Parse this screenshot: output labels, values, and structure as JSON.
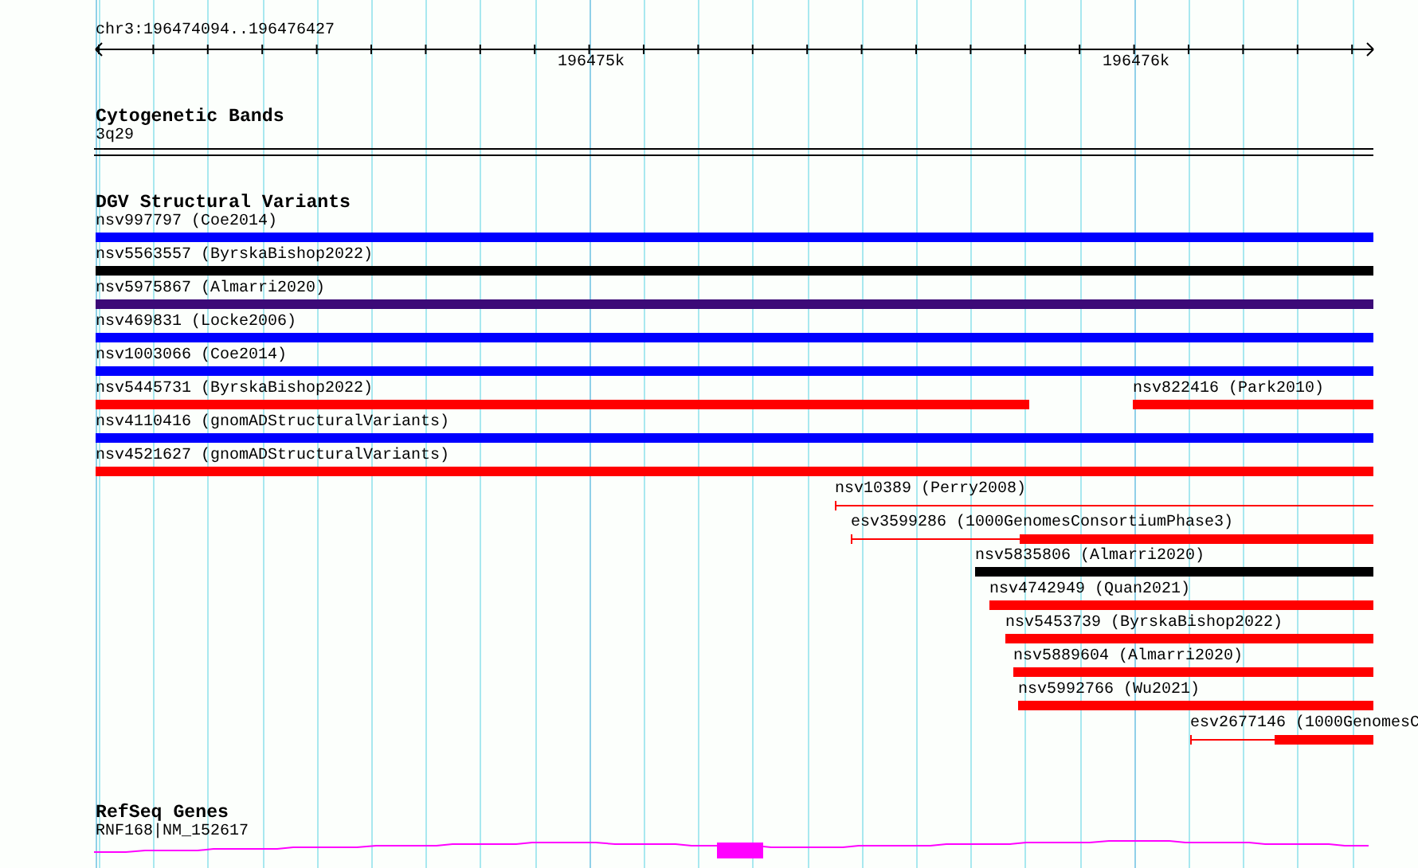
{
  "ruler": {
    "location": "chr3:196474094..196476427",
    "ticks": [
      "196475k",
      "196476k"
    ]
  },
  "tracks": [
    {
      "kind": "bands",
      "title": "Cytogenetic Bands",
      "features": [
        {
          "label": "3q29"
        }
      ]
    },
    {
      "kind": "variants",
      "title": "DGV Structural Variants",
      "rows": [
        [
          {
            "label": "nsv997797 (Coe2014)",
            "color": "#0000ff",
            "kind": "solid"
          }
        ],
        [
          {
            "label": "nsv5563557 (ByrskaBishop2022)",
            "color": "#000000",
            "kind": "solid"
          }
        ],
        [
          {
            "label": "nsv5975867 (Almarri2020)",
            "color": "#3c0a78",
            "kind": "solid"
          }
        ],
        [
          {
            "label": "nsv469831 (Locke2006)",
            "color": "#0000ff",
            "kind": "solid"
          }
        ],
        [
          {
            "label": "nsv1003066 (Coe2014)",
            "color": "#0000ff",
            "kind": "solid"
          }
        ],
        [
          {
            "label": "nsv5445731 (ByrskaBishop2022)",
            "color": "#ff0000",
            "kind": "solid"
          },
          {
            "label": "nsv822416 (Park2010)",
            "color": "#ff0000",
            "kind": "solid"
          }
        ],
        [
          {
            "label": "nsv4110416 (gnomADStructuralVariants)",
            "color": "#0000ff",
            "kind": "solid"
          }
        ],
        [
          {
            "label": "nsv4521627 (gnomADStructuralVariants)",
            "color": "#ff0000",
            "kind": "solid"
          }
        ],
        [
          {
            "label": "nsv10389 (Perry2008)",
            "color": "#ff0000",
            "kind": "thin"
          }
        ],
        [
          {
            "label": "esv3599286 (1000GenomesConsortiumPhase3)",
            "color": "#ff0000",
            "kind": "partial"
          }
        ],
        [
          {
            "label": "nsv5835806 (Almarri2020)",
            "color": "#000000",
            "kind": "solid"
          }
        ],
        [
          {
            "label": "nsv4742949 (Quan2021)",
            "color": "#ff0000",
            "kind": "solid"
          }
        ],
        [
          {
            "label": "nsv5453739 (ByrskaBishop2022)",
            "color": "#ff0000",
            "kind": "solid"
          }
        ],
        [
          {
            "label": "nsv5889604 (Almarri2020)",
            "color": "#ff0000",
            "kind": "solid"
          }
        ],
        [
          {
            "label": "nsv5992766 (Wu2021)",
            "color": "#ff0000",
            "kind": "solid"
          }
        ],
        [
          {
            "label": "esv2677146 (1000GenomesC",
            "color": "#ff0000",
            "kind": "partial"
          }
        ]
      ]
    },
    {
      "kind": "genes",
      "title": "RefSeq Genes",
      "features": [
        {
          "label": "RNF168|NM_152617"
        }
      ]
    }
  ]
}
